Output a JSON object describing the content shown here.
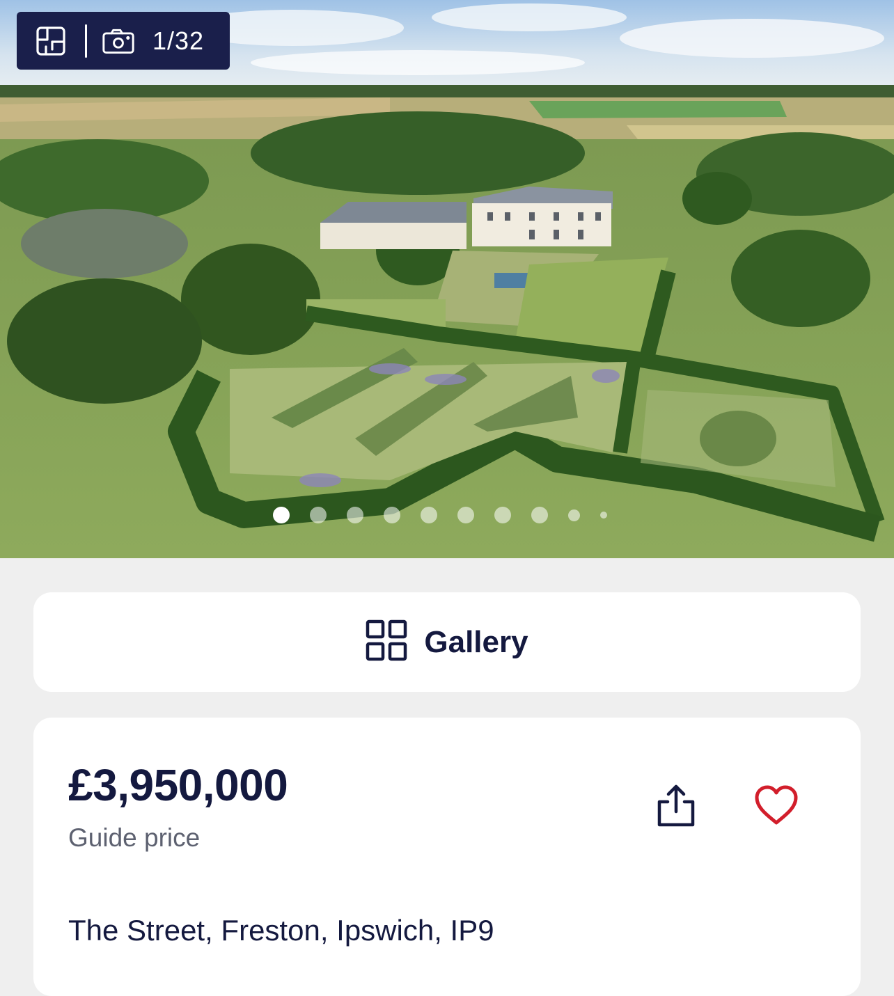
{
  "hero": {
    "photo_alt_icon": "floorplan-icon",
    "camera_icon": "camera-icon",
    "photo_counter": "1/32",
    "carousel_dots": 10,
    "active_dot": 1
  },
  "gallery_button": {
    "icon": "grid-icon",
    "label": "Gallery"
  },
  "listing": {
    "price": "£3,950,000",
    "price_qualifier": "Guide price",
    "address": "The Street, Freston, Ipswich, IP9",
    "share_icon": "share-icon",
    "favourite_icon": "heart-icon"
  },
  "colors": {
    "navy": "#14193f",
    "chip_bg": "#1a1f4b",
    "heart_red": "#d21e2b",
    "page_bg": "#efefef"
  }
}
